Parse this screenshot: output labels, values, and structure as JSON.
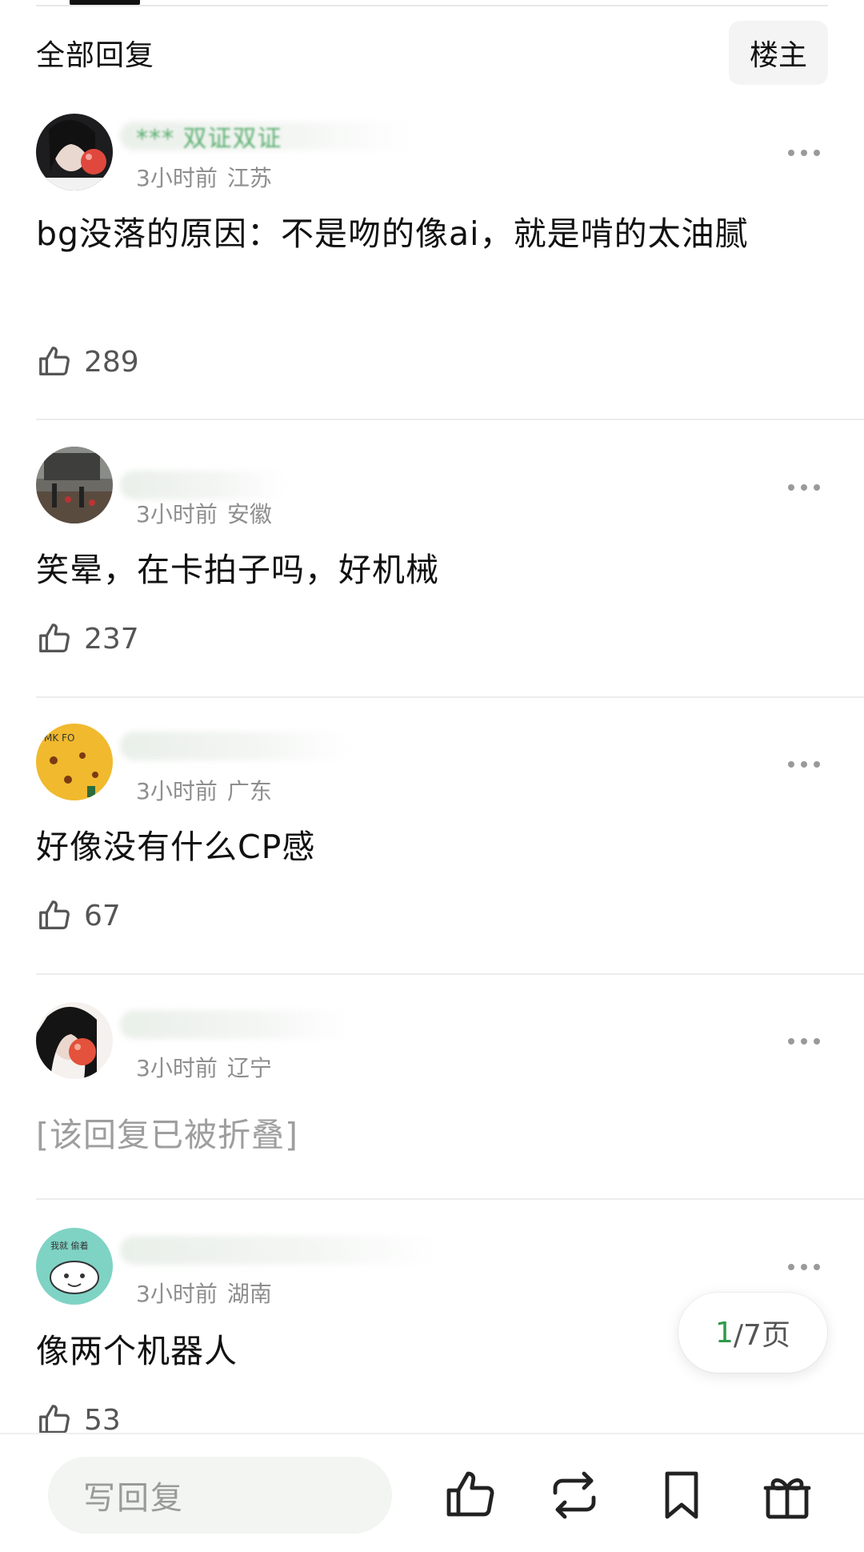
{
  "header": {
    "title": "全部回复",
    "owner_filter_label": "楼主"
  },
  "comments": [
    {
      "username": "*** 双证双证",
      "time": "3小时前",
      "location": "江苏",
      "content": "bg没落的原因：不是吻的像ai，就是啃的太油腻",
      "likes": "289"
    },
    {
      "username": "",
      "time": "3小时前",
      "location": "安徽",
      "content": "笑晕，在卡拍子吗，好机械",
      "likes": "237"
    },
    {
      "username": "",
      "time": "3小时前",
      "location": "广东",
      "content": "好像没有什么CP感",
      "likes": "67"
    },
    {
      "username": "",
      "time": "3小时前",
      "location": "辽宁",
      "content": "[该回复已被折叠]",
      "likes": ""
    },
    {
      "username": "",
      "time": "3小时前",
      "location": "湖南",
      "content": "像两个机器人",
      "likes": "53"
    }
  ],
  "pagination": {
    "current": "1",
    "rest": "/7页"
  },
  "bottom_bar": {
    "reply_placeholder": "写回复",
    "icons": [
      "thumbs-up-icon",
      "repost-icon",
      "bookmark-icon",
      "gift-icon"
    ]
  },
  "colors": {
    "accent_green": "#2f9a4a",
    "meta_gray": "#8e8e8e",
    "divider": "#ececec"
  }
}
